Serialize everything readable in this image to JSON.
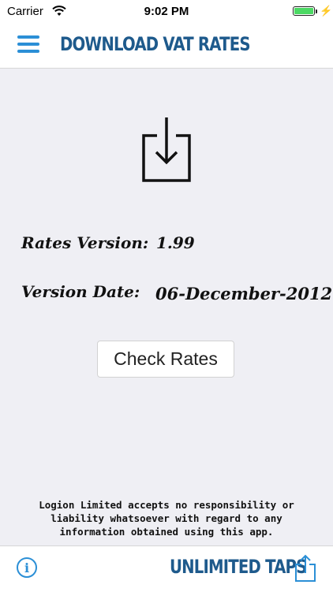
{
  "status_bar": {
    "carrier": "Carrier",
    "time": "9:02 PM",
    "battery_level": 1.0,
    "battery_color": "#4cd964"
  },
  "nav": {
    "title": "DOWNLOAD VAT RATES",
    "menu_icon": "hamburger-menu-icon",
    "accent_color": "#2b8fd6",
    "title_color": "#1e5a8c"
  },
  "main": {
    "icon": "download-tray-icon",
    "rates_version_label": "Rates Version:",
    "rates_version_value": "1.99",
    "version_date_label": "Version Date:",
    "version_date_value": "06-December-2012",
    "check_button_label": "Check Rates"
  },
  "disclaimer": "Logion Limited accepts no responsibility or liability whatsoever with regard to any information obtained using this app.",
  "bottom_bar": {
    "info_icon": "info-icon",
    "info_glyph": "i",
    "unlimited_label": "UNLIMITED TAPS",
    "share_icon": "share-icon"
  }
}
